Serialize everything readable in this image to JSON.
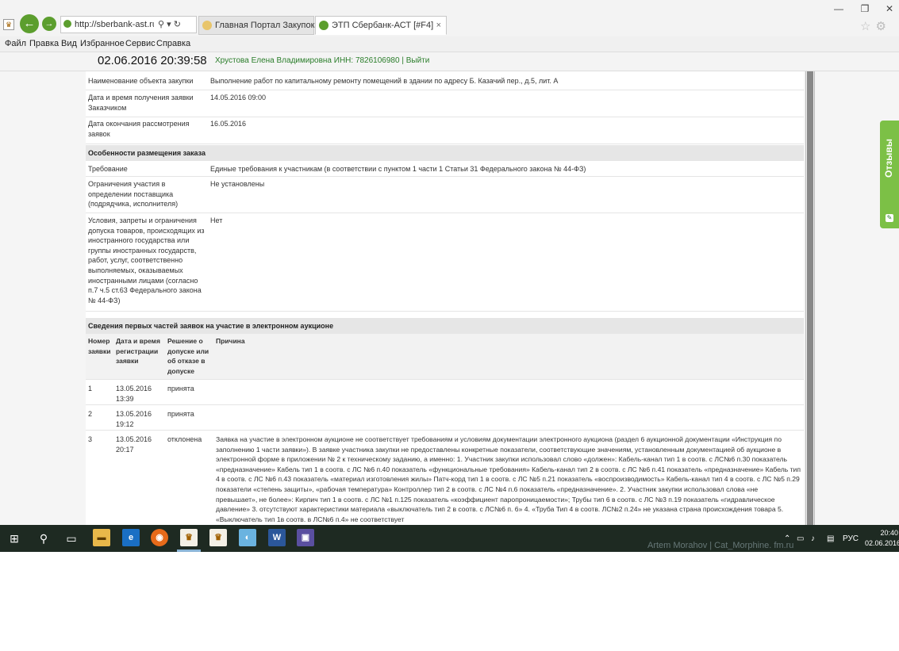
{
  "browser": {
    "address": "http://sberbank-ast.ru/Viev",
    "tabs": [
      {
        "label": "Главная Портал Закупок"
      },
      {
        "label": "ЭТП Сбербанк-АСТ [#F4]"
      }
    ],
    "menu": [
      "Файл",
      "Правка",
      "Вид",
      "Избранное",
      "Сервис",
      "Справка"
    ],
    "tab_close": "×",
    "window_controls": [
      "—",
      "❐",
      "✕"
    ]
  },
  "header": {
    "datetime": "02.06.2016  20:39:58",
    "user": "Хрустова Елена Владимировна ИНН: 7826106980  |  Выйти"
  },
  "details": [
    {
      "label": "Наименование объекта закупки",
      "value": "Выполнение работ по капитальному ремонту помещений в здании по адресу Б. Казачий пер., д.5, лит. А"
    },
    {
      "label": "Дата и время получения заявки Заказчиком",
      "value": "14.05.2016 09:00"
    },
    {
      "label": "Дата окончания рассмотрения заявок",
      "value": "16.05.2016"
    }
  ],
  "features": {
    "title": "Особенности размещения заказа",
    "rows": [
      {
        "label": "Требование",
        "value": "Единые требования к участникам (в соответствии с пунктом 1 части 1 Статьи 31 Федерального закона № 44-ФЗ)"
      },
      {
        "label": "Ограничения участия в определении поставщика (подрядчика, исполнителя)",
        "value": "Не установлены"
      },
      {
        "label": "Условия, запреты и ограничения допуска товаров, происходящих из иностранного государства или группы иностранных государств, работ, услуг, соответственно выполняемых, оказываемых иностранными лицами (согласно п.7 ч.5 ст.63 Федерального закона № 44-ФЗ)",
        "value": "Нет"
      }
    ]
  },
  "applications": {
    "title": "Сведения первых частей заявок на участие в электронном аукционе",
    "columns": [
      "Номер заявки",
      "Дата и время регистрации заявки",
      "Решение о допуске или об отказе в допуске",
      "Причина"
    ],
    "rows": [
      {
        "num": "1",
        "date": "13.05.2016 13:39",
        "decision": "принята",
        "reason": ""
      },
      {
        "num": "2",
        "date": "13.05.2016 19:12",
        "decision": "принята",
        "reason": ""
      },
      {
        "num": "3",
        "date": "13.05.2016 20:17",
        "decision": "отклонена",
        "reason": "Заявка на участие в электронном аукционе не соответствует требованиям и условиям документации электронного аукциона (раздел 6 аукционной документации «Инструкция по заполнению 1 части заявки»). В заявке участника закупки не предоставлены конкретные показатели, соответствующие значениям, установленным документацией об аукционе в электронной форме в приложении № 2 к техническому заданию, а именно: 1. Участник закупки использовал слово «должен»: Кабель-канал тип 1 в соотв. с ЛС№6 п.30 показатель «предназначение» Кабель тип 1 в соотв. с ЛС №6 п.40 показатель «функциональные требования» Кабель-канал тип 2 в соотв. с ЛС №6 п.41 показатель «предназначение» Кабель тип 4 в соотв. с ЛС №6 п.43 показатель «материал изготовления жилы» Патч-корд тип 1 в соотв. с ЛС №5 п.21 показатель «воспроизводимость» Кабель-канал тип 4 в соотв. с ЛС №5 п.29 показатели «степень защиты», «рабочая температура» Контроллер тип 2 в соотв. с ЛС №4 п.6 показатель «предназначение». 2. Участник закупки использовал слова «не превышает», не более»: Кирпич тип 1 в соотв. с ЛС №1 п.125 показатель «коэффициент паропроницаемости»; Трубы тип 6 в соотв. с ЛС №3 п.19 показатель «гидравлическое давление» 3. отсутствуют характеристики материала «выключатель тип 2 в соотв. с ЛС№6 п. 6» 4. «Труба Тип 4 в соотв. ЛС№2 п.24» не указана страна происхождения товара 5. «Выключатель тип 1в соотв. в ЛС№6 п.4» не соответствует"
      }
    ]
  },
  "feedback": {
    "label": "Отзывы"
  },
  "taskbar": {
    "apps": [
      "start",
      "search",
      "task-view",
      "file-explorer",
      "internet-explorer",
      "firefox",
      "sberbank-app-1",
      "sberbank-app-2",
      "photos",
      "word",
      "save"
    ],
    "wallpaper_text": "Artem Morahov | Cat_Morphine. fm.ru",
    "lang": "РУС",
    "time": "20:40",
    "date": "02.06.2016"
  }
}
